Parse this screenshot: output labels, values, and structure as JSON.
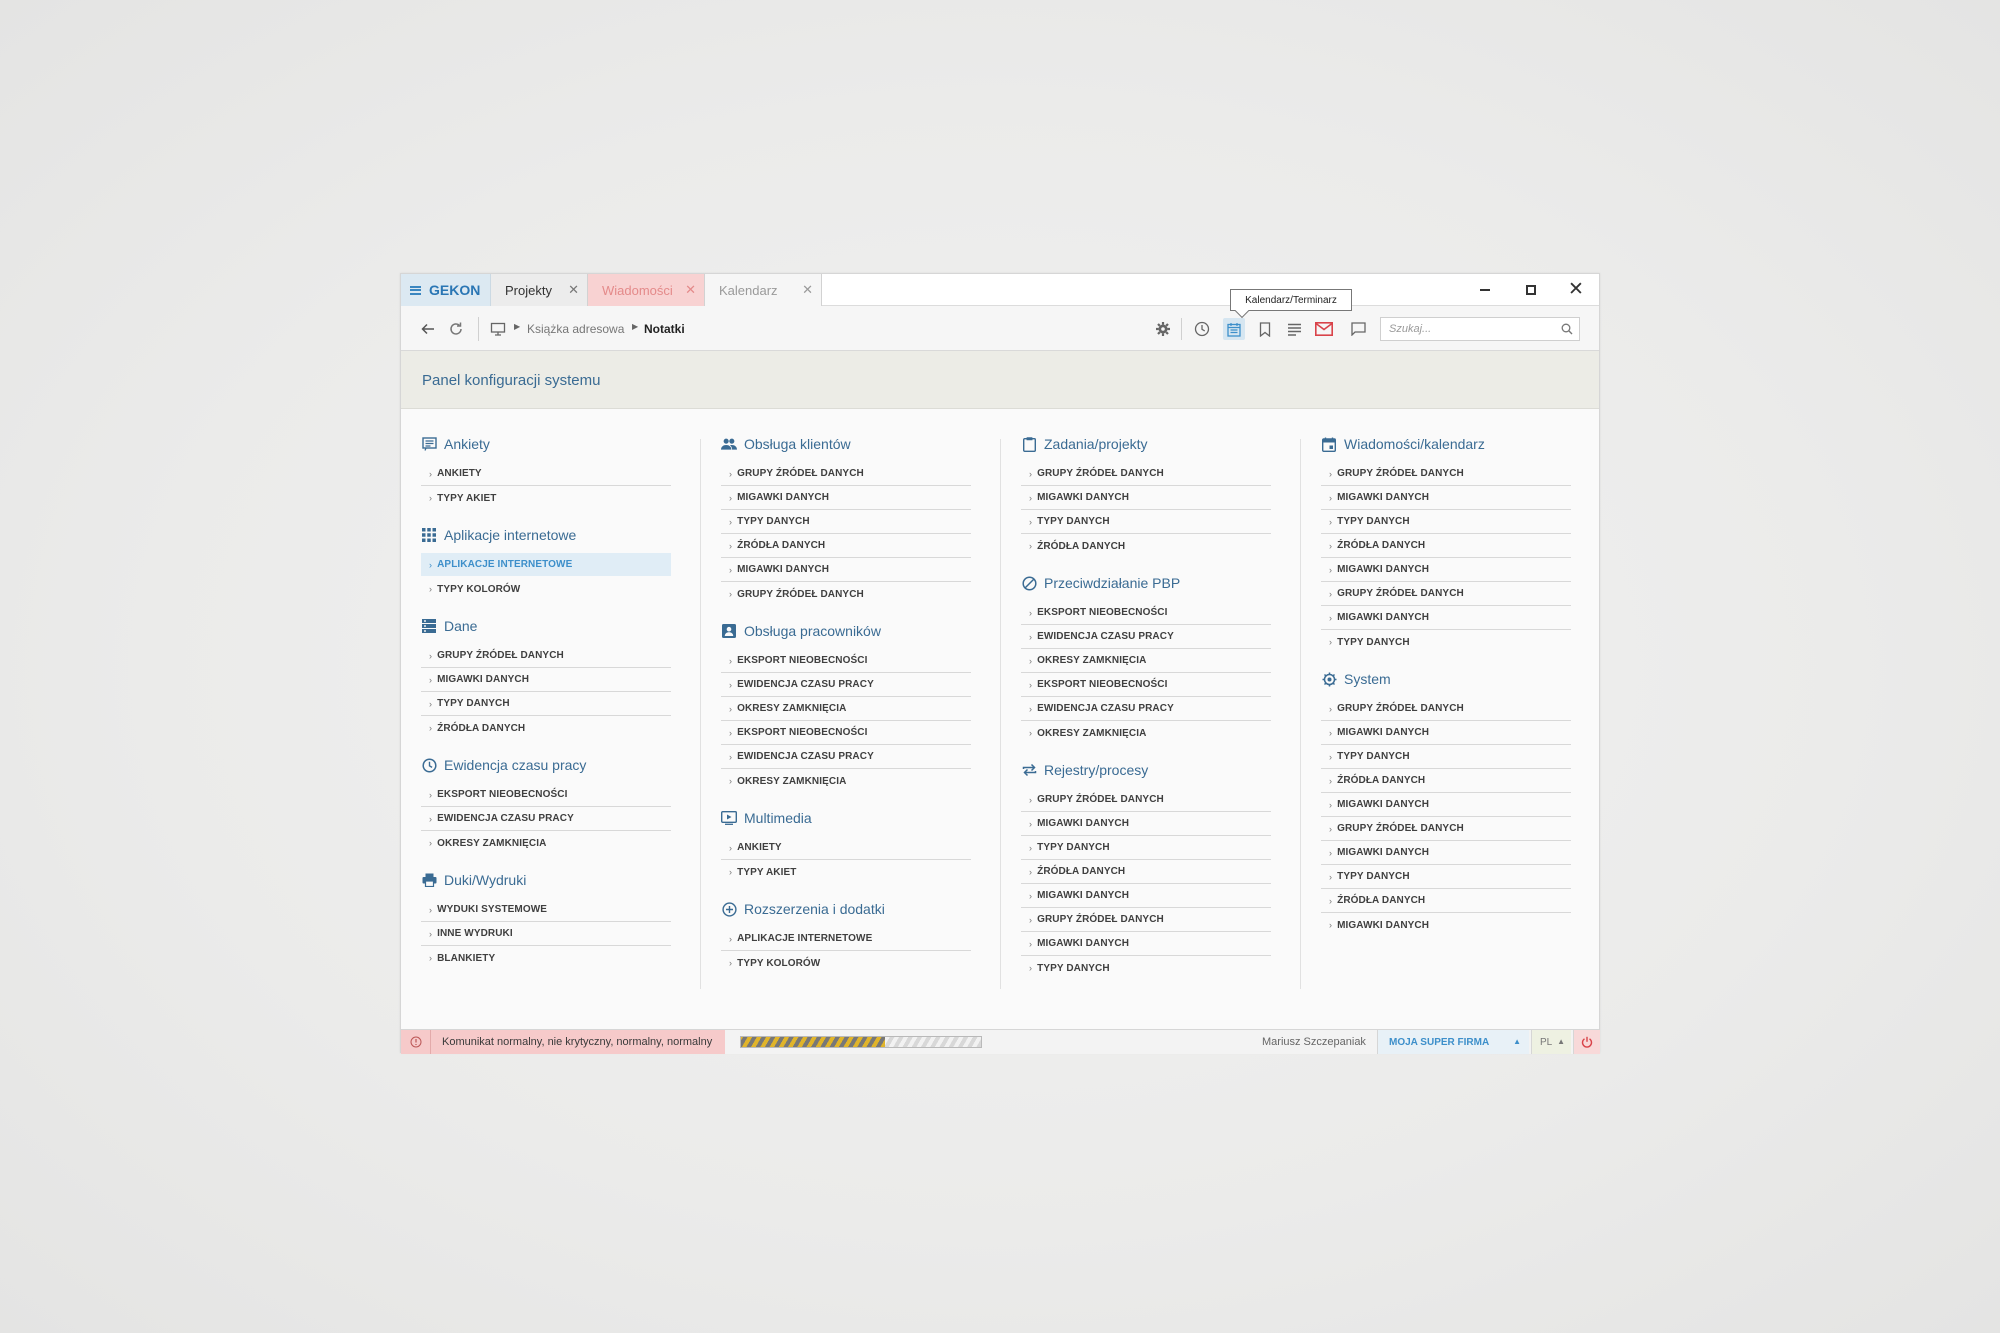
{
  "window": {
    "brand": "GEKON",
    "tabs": [
      {
        "label": "Projekty"
      },
      {
        "label": "Wiadomości"
      },
      {
        "label": "Kalendarz"
      }
    ],
    "tooltip": "Kalendarz/Terminarz"
  },
  "toolbar": {
    "breadcrumb": [
      "Książka adresowa",
      "Notatki"
    ],
    "search_placeholder": "Szukaj..."
  },
  "panel": {
    "title": "Panel konfiguracji systemu"
  },
  "columns": [
    [
      {
        "title": "Ankiety",
        "icon": "survey-icon",
        "items": [
          "ANKIETY",
          "TYPY AKIET"
        ]
      },
      {
        "title": "Aplikacje internetowe",
        "icon": "apps-grid-icon",
        "items": [
          "APLIKACJE INTERNETOWE",
          "TYPY KOLORÓW"
        ],
        "active": 0
      },
      {
        "title": "Dane",
        "icon": "storage-icon",
        "items": [
          "GRUPY ŹRÓDEŁ DANYCH",
          "MIGAWKI DANYCH",
          "TYPY DANYCH",
          "ŹRÓDŁA DANYCH"
        ]
      },
      {
        "title": "Ewidencja czasu pracy",
        "icon": "clock-icon",
        "items": [
          "EKSPORT NIEOBECNOŚCI",
          "EWIDENCJA CZASU PRACY",
          "OKRESY ZAMKNIĘCIA"
        ]
      },
      {
        "title": "Duki/Wydruki",
        "icon": "printer-icon",
        "items": [
          "WYDUKI SYSTEMOWE",
          "INNE WYDRUKI",
          "BLANKIETY"
        ]
      }
    ],
    [
      {
        "title": "Obsługa klientów",
        "icon": "people-icon",
        "items": [
          "GRUPY ŹRÓDEŁ DANYCH",
          "MIGAWKI DANYCH",
          "TYPY DANYCH",
          "ŹRÓDŁA DANYCH",
          "MIGAWKI DANYCH",
          "GRUPY ŹRÓDEŁ DANYCH"
        ]
      },
      {
        "title": "Obsługa pracowników",
        "icon": "contact-card-icon",
        "items": [
          "EKSPORT NIEOBECNOŚCI",
          "EWIDENCJA CZASU PRACY",
          "OKRESY ZAMKNIĘCIA",
          "EKSPORT NIEOBECNOŚCI",
          "EWIDENCJA CZASU PRACY",
          "OKRESY ZAMKNIĘCIA"
        ]
      },
      {
        "title": "Multimedia",
        "icon": "video-play-icon",
        "items": [
          "ANKIETY",
          "TYPY AKIET"
        ]
      },
      {
        "title": "Rozszerzenia i dodatki",
        "icon": "plus-circle-icon",
        "items": [
          "APLIKACJE INTERNETOWE",
          "TYPY KOLORÓW"
        ]
      }
    ],
    [
      {
        "title": "Zadania/projekty",
        "icon": "clipboard-icon",
        "items": [
          "GRUPY ŹRÓDEŁ DANYCH",
          "MIGAWKI DANYCH",
          "TYPY DANYCH",
          "ŹRÓDŁA DANYCH"
        ]
      },
      {
        "title": "Przeciwdziałanie PBP",
        "icon": "block-icon",
        "items": [
          "EKSPORT NIEOBECNOŚCI",
          "EWIDENCJA CZASU PRACY",
          "OKRESY ZAMKNIĘCIA",
          "EKSPORT NIEOBECNOŚCI",
          "EWIDENCJA CZASU PRACY",
          "OKRESY ZAMKNIĘCIA"
        ]
      },
      {
        "title": "Rejestry/procesy",
        "icon": "repeat-icon",
        "items": [
          "GRUPY ŹRÓDEŁ DANYCH",
          "MIGAWKI DANYCH",
          "TYPY DANYCH",
          "ŹRÓDŁA DANYCH",
          "MIGAWKI DANYCH",
          "GRUPY ŹRÓDEŁ DANYCH",
          "MIGAWKI DANYCH",
          "TYPY DANYCH"
        ]
      }
    ],
    [
      {
        "title": "Wiadomości/kalendarz",
        "icon": "calendar-event-icon",
        "items": [
          "GRUPY ŹRÓDEŁ DANYCH",
          "MIGAWKI DANYCH",
          "TYPY DANYCH",
          "ŹRÓDŁA DANYCH",
          "MIGAWKI DANYCH",
          "GRUPY ŹRÓDEŁ DANYCH",
          "MIGAWKI DANYCH",
          "TYPY DANYCH"
        ]
      },
      {
        "title": "System",
        "icon": "settings-chip-icon",
        "items": [
          "GRUPY ŹRÓDEŁ DANYCH",
          "MIGAWKI DANYCH",
          "TYPY DANYCH",
          "ŹRÓDŁA DANYCH",
          "MIGAWKI DANYCH",
          "GRUPY ŹRÓDEŁ DANYCH",
          "MIGAWKI DANYCH",
          "TYPY DANYCH",
          "ŹRÓDŁA DANYCH",
          "MIGAWKI DANYCH"
        ]
      }
    ]
  ],
  "statusbar": {
    "message": "Komunikat normalny, nie krytyczny, normalny, normalny",
    "progress": 0.6,
    "user": "Mariusz Szczepaniak",
    "company": "MOJA SUPER FIRMA",
    "language": "PL"
  },
  "colors": {
    "accent": "#3d8fca",
    "heading": "#3a6b93",
    "alert_bg": "#f6caca",
    "header_bg": "#ecece6"
  }
}
